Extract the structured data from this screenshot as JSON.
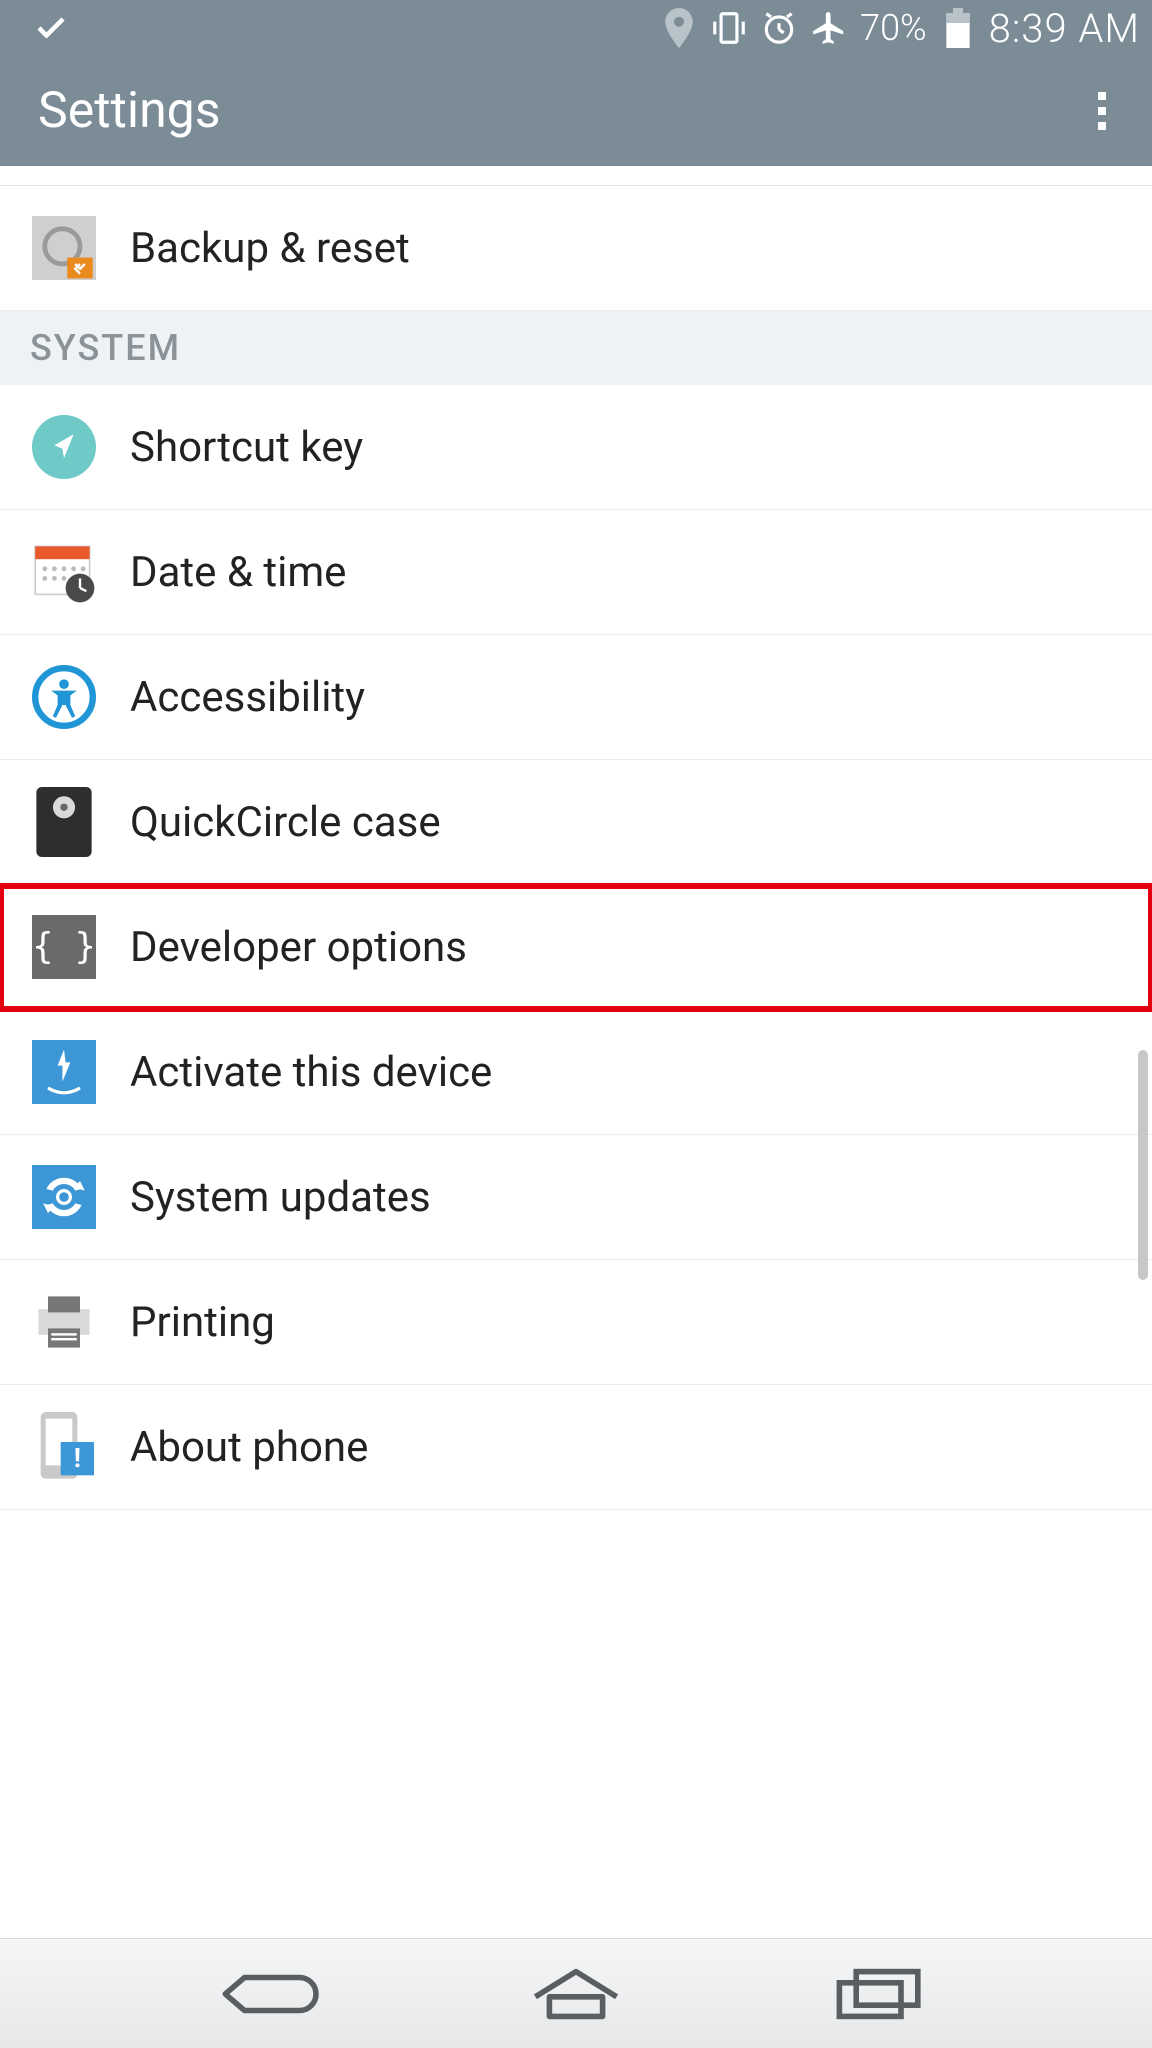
{
  "status": {
    "battery": "70%",
    "time": "8:39 AM"
  },
  "app": {
    "title": "Settings"
  },
  "section_header": "SYSTEM",
  "items": {
    "backup": "Backup & reset",
    "shortcut": "Shortcut key",
    "date": "Date & time",
    "accessibility": "Accessibility",
    "quickcircle": "QuickCircle case",
    "developer": "Developer options",
    "activate": "Activate this device",
    "updates": "System updates",
    "printing": "Printing",
    "about": "About phone"
  }
}
